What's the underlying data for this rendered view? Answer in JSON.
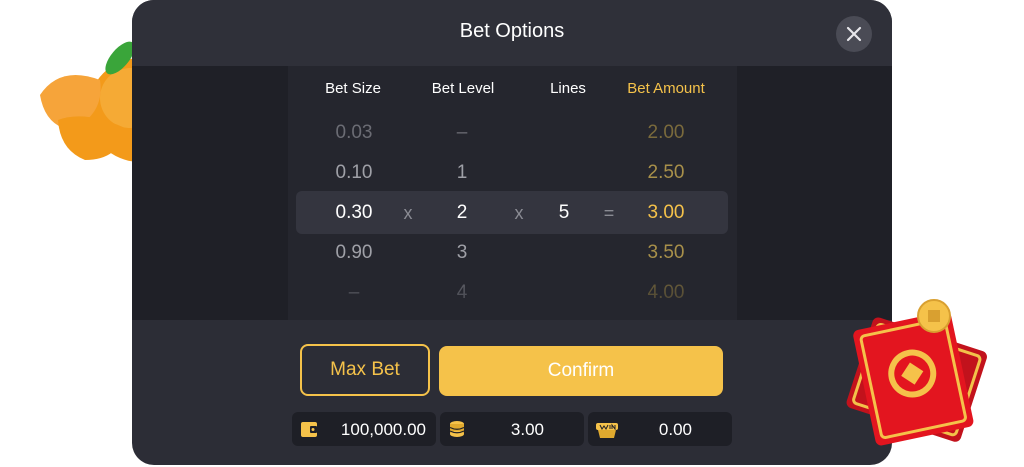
{
  "dialog": {
    "title": "Bet Options",
    "close_icon": "close-icon"
  },
  "columns": {
    "bet_size": "Bet Size",
    "bet_level": "Bet Level",
    "lines": "Lines",
    "bet_amount": "Bet Amount"
  },
  "rows": [
    {
      "bet_size": "0.03",
      "bet_level": "–",
      "bet_amount": "2.00"
    },
    {
      "bet_size": "0.10",
      "bet_level": "1",
      "bet_amount": "2.50"
    },
    {
      "bet_size": "0.30",
      "bet_level": "2",
      "lines": "5",
      "bet_amount": "3.00"
    },
    {
      "bet_size": "0.90",
      "bet_level": "3",
      "bet_amount": "3.50"
    },
    {
      "bet_size": "–",
      "bet_level": "4",
      "bet_amount": "4.00"
    }
  ],
  "operators": {
    "times": "x",
    "equals": "="
  },
  "buttons": {
    "max_bet": "Max Bet",
    "confirm": "Confirm"
  },
  "stats": {
    "balance": "100,000.00",
    "bet": "3.00",
    "win": "0.00"
  },
  "colors": {
    "accent": "#f5c24a",
    "panel": "#2c2d36",
    "table_bg": "#25262e"
  },
  "icons": [
    "wallet-icon",
    "coin-stack-icon",
    "win-icon",
    "tangerine-icon",
    "red-envelope-icon"
  ]
}
